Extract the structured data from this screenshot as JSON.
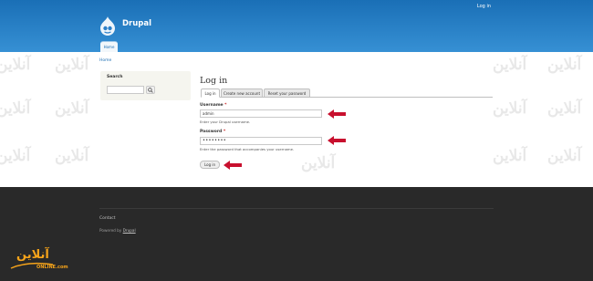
{
  "header": {
    "login_link": "Log in",
    "site_name": "Drupal",
    "nav_tab": "Home"
  },
  "breadcrumb": "Home",
  "sidebar": {
    "search_title": "Search",
    "search_input_value": ""
  },
  "main": {
    "title": "Log in",
    "tabs": [
      {
        "label": "Log in",
        "active": true
      },
      {
        "label": "Create new account",
        "active": false
      },
      {
        "label": "Reset your password",
        "active": false
      }
    ],
    "username": {
      "label": "Username",
      "required_mark": "*",
      "value": "admin",
      "description": "Enter your Drupal username."
    },
    "password": {
      "label": "Password",
      "required_mark": "*",
      "value": "••••••••",
      "description": "Enter the password that accompanies your username."
    },
    "submit_label": "Log in"
  },
  "footer": {
    "contact": "Contact",
    "powered_prefix": "Powered by",
    "powered_link": "Drupal"
  },
  "watermark": {
    "brand_text": "آنلاین",
    "brand_sub": "ONLINE.com"
  },
  "colors": {
    "header_blue": "#2b7fc8",
    "footer_dark": "#292929",
    "arrow_red": "#c8102e",
    "brand_orange": "#f5a31a"
  }
}
